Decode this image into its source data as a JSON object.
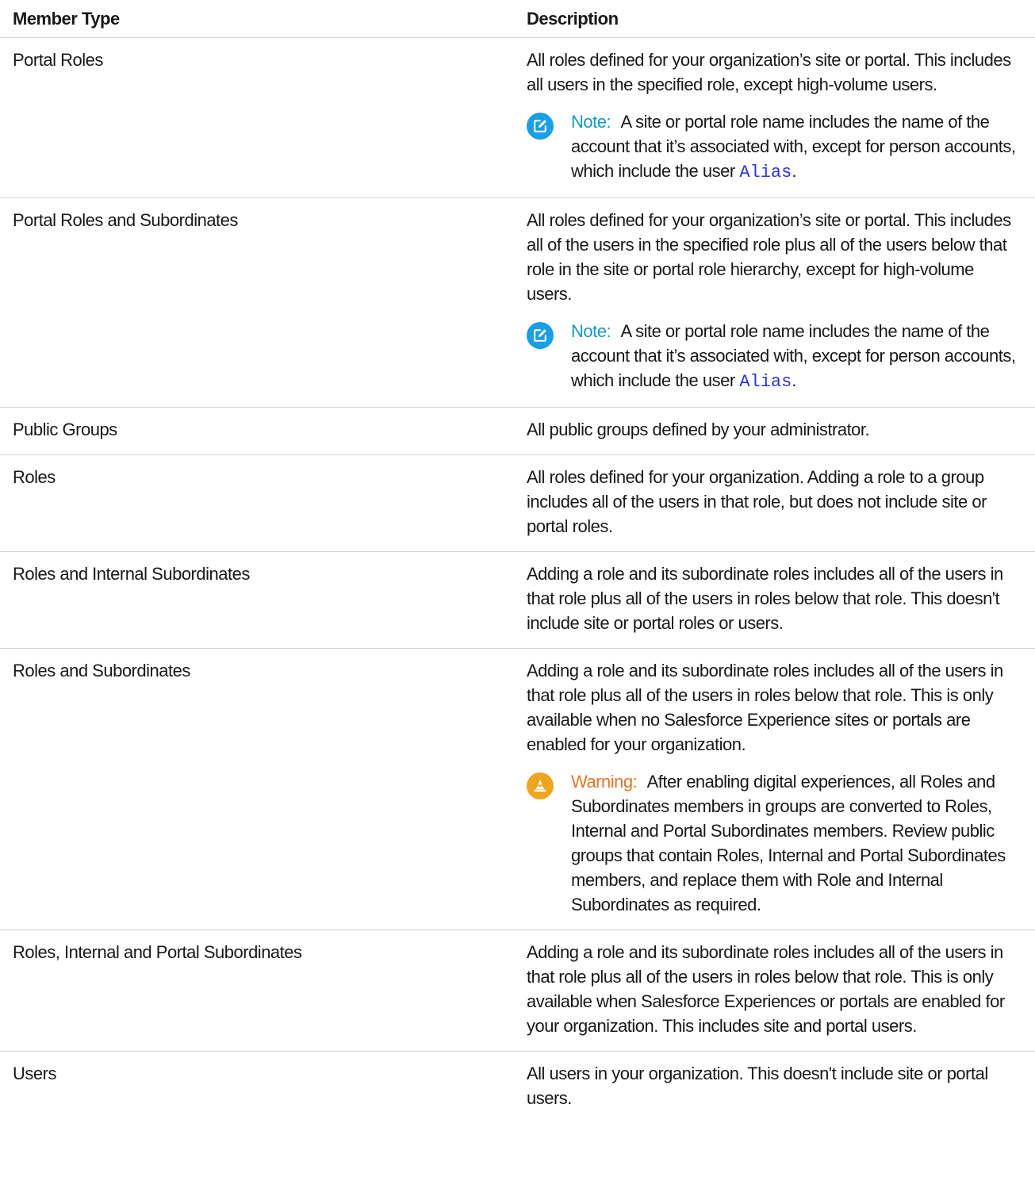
{
  "table": {
    "headers": {
      "member_type": "Member Type",
      "description": "Description"
    },
    "rows": [
      {
        "member_type": "Portal Roles",
        "description": "All roles defined for your organization’s site or portal. This includes all users in the specified role, except high-volume users.",
        "note": {
          "label": "Note:",
          "text_before": "A site or portal role name includes the name of the account that it’s associated with, except for person accounts, which include the user",
          "code": "Alias",
          "text_after": "."
        }
      },
      {
        "member_type": "Portal Roles and Subordinates",
        "description": "All roles defined for your organization’s site or portal. This includes all of the users in the specified role plus all of the users below that role in the site or portal role hierarchy, except for high-volume users.",
        "note": {
          "label": "Note:",
          "text_before": "A site or portal role name includes the name of the account that it’s associated with, except for person accounts, which include the user",
          "code": "Alias",
          "text_after": "."
        }
      },
      {
        "member_type": "Public Groups",
        "description": "All public groups defined by your administrator."
      },
      {
        "member_type": "Roles",
        "description": "All roles defined for your organization. Adding a role to a group includes all of the users in that role, but does not include site or portal roles."
      },
      {
        "member_type": "Roles and Internal Subordinates",
        "description": "Adding a role and its subordinate roles includes all of the users in that role plus all of the users in roles below that role. This doesn't include site or portal roles or users."
      },
      {
        "member_type": "Roles and Subordinates",
        "description": "Adding a role and its subordinate roles includes all of the users in that role plus all of the users in roles below that role. This is only available when no Salesforce Experience sites or portals are enabled for your organization.",
        "warning": {
          "label": "Warning:",
          "text": "After enabling digital experiences, all Roles and Subordinates members in groups are converted to Roles, Internal and Portal Subordinates members. Review public groups that contain Roles, Internal and Portal Subordinates members, and replace them with Role and Internal Subordinates as required."
        }
      },
      {
        "member_type": "Roles, Internal and Portal Subordinates",
        "description": "Adding a role and its subordinate roles includes all of the users in that role plus all of the users in roles below that role. This is only available when Salesforce Experiences or portals are enabled for your organization. This includes site and portal users."
      },
      {
        "member_type": "Users",
        "description": "All users in your organization. This doesn't include site or portal users."
      }
    ]
  },
  "icons": {
    "note": "edit-note-icon",
    "warning": "warning-cone-icon"
  },
  "colors": {
    "note_label": "#1798c1",
    "note_icon": "#1a9ee6",
    "warning_label": "#e4742a",
    "warning_icon": "#f0a520",
    "code": "#2a33d8"
  }
}
